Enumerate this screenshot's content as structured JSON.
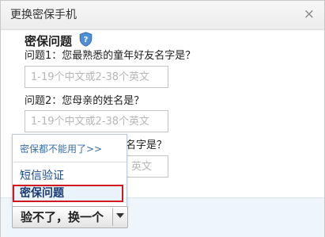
{
  "dialog": {
    "title": "更换密保手机",
    "close_symbol": "×"
  },
  "section": {
    "title": "密保问题",
    "icon": "shield-question-icon"
  },
  "questions": [
    {
      "label": "问题1：您最熟悉的童年好友名字是？",
      "placeholder": "1-19个中文或2-38个英文"
    },
    {
      "label": "问题2：您母亲的姓名是？",
      "placeholder": "1-19个中文或2-38个英文"
    },
    {
      "label_visible_tail": "名字是？",
      "placeholder_visible_tail": "英文"
    }
  ],
  "dropdown": {
    "link": "密保都不能用了>>",
    "items": [
      {
        "label": "短信验证",
        "selected": false
      },
      {
        "label": "密保问题",
        "selected": true
      }
    ]
  },
  "switch_button": {
    "label": "验不了，换一个",
    "arrow_icon": "caret-down-icon"
  },
  "colors": {
    "link": "#3a6ea5",
    "item_text": "#1a4a86",
    "highlight_border": "#d0191f",
    "footer_background": "#eef6fc",
    "shield_icon": "#4f8fd6"
  }
}
